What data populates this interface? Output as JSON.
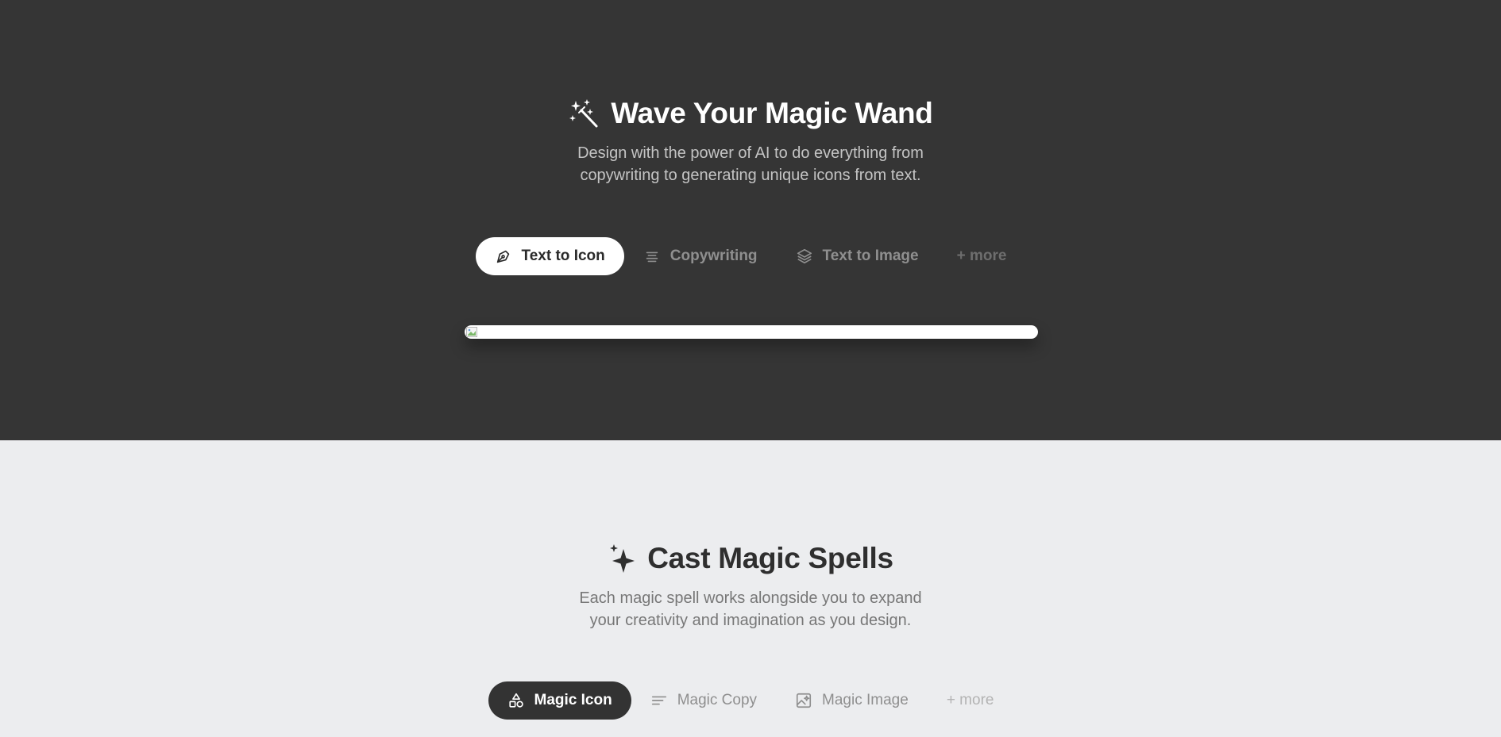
{
  "hero": {
    "title": "Wave Your Magic Wand",
    "title_icon": "magic-wand-icon",
    "subtitle_line1": "Design with the power of AI to do everything from",
    "subtitle_line2": "copywriting to generating unique icons from text.",
    "tabs": [
      {
        "label": "Text to Icon",
        "icon": "pen-nib-icon",
        "active": true
      },
      {
        "label": "Copywriting",
        "icon": "text-align-icon",
        "active": false
      },
      {
        "label": "Text to Image",
        "icon": "layers-icon",
        "active": false
      },
      {
        "label": "+ more",
        "icon": "",
        "active": false
      }
    ]
  },
  "spells": {
    "title": "Cast Magic Spells",
    "title_icon": "sparkles-icon",
    "subtitle_line1": "Each magic spell works alongside you to expand",
    "subtitle_line2": "your creativity and imagination as you design.",
    "tabs": [
      {
        "label": "Magic Icon",
        "icon": "shapes-icon",
        "active": true
      },
      {
        "label": "Magic Copy",
        "icon": "text-lines-icon",
        "active": false
      },
      {
        "label": "Magic Image",
        "icon": "image-sparkle-icon",
        "active": false
      },
      {
        "label": "+ more",
        "icon": "",
        "active": false
      }
    ]
  },
  "colors": {
    "hero_bg": "#353535",
    "light_bg": "#ecedef",
    "active_dark": "#333333"
  }
}
